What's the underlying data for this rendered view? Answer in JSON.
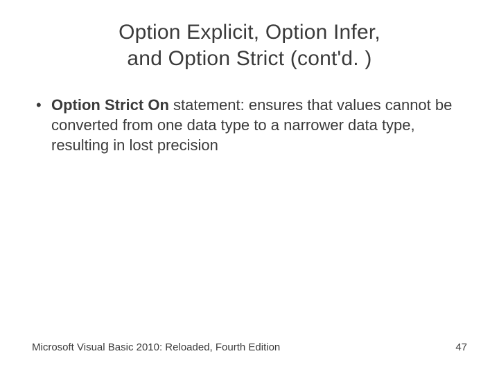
{
  "title": {
    "line1": "Option Explicit, Option Infer,",
    "line2": "and Option Strict (cont'd. )"
  },
  "bullets": [
    {
      "bold": "Option Strict On",
      "rest": " statement: ensures that values cannot be converted from one data type to a narrower data type, resulting in lost precision"
    }
  ],
  "footer": {
    "left": "Microsoft Visual Basic 2010: Reloaded, Fourth Edition",
    "right": "47"
  }
}
